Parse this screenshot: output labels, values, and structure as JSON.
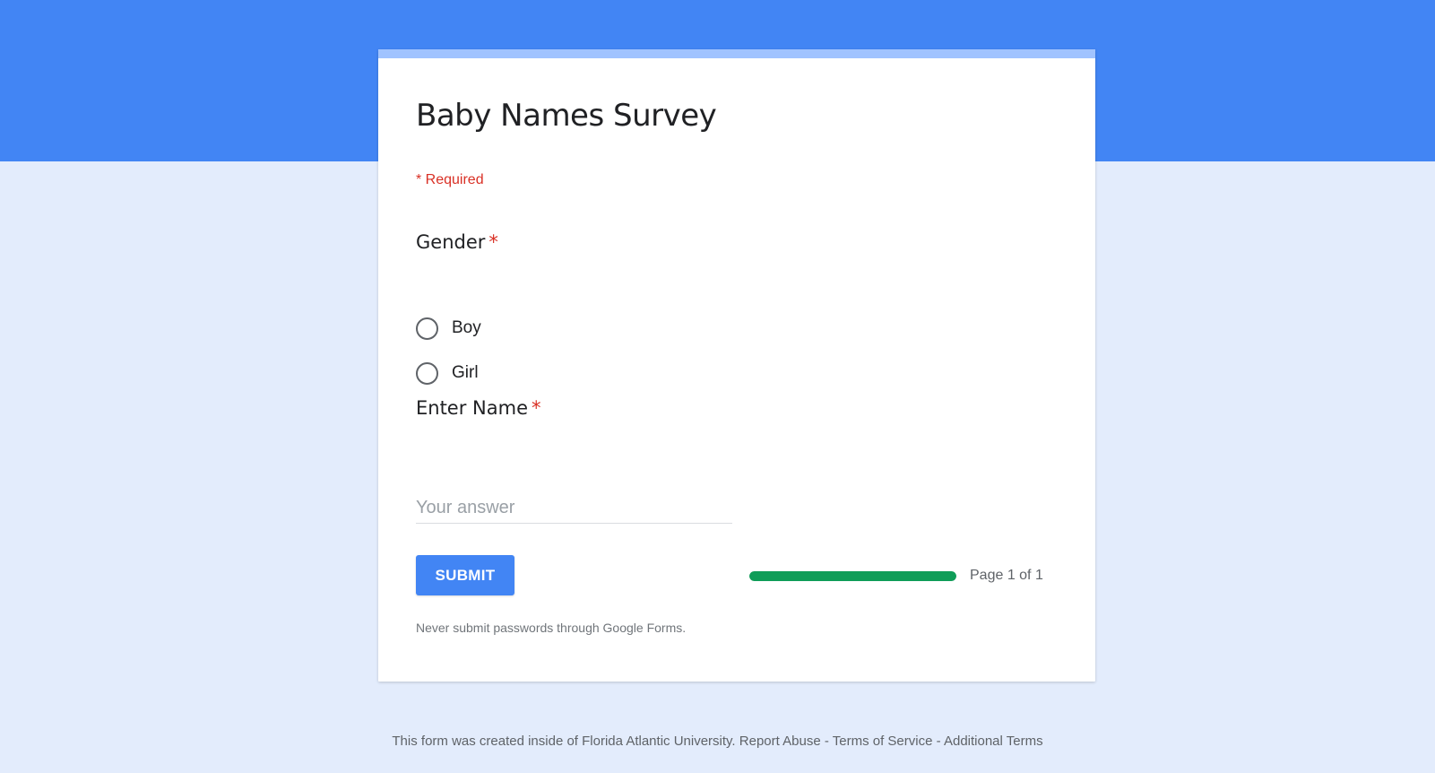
{
  "form": {
    "title": "Baby Names Survey",
    "required_note": "* Required",
    "questions": [
      {
        "title": "Gender",
        "required_mark": "*",
        "options": [
          "Boy",
          "Girl"
        ]
      },
      {
        "title": "Enter Name",
        "required_mark": "*",
        "placeholder": "Your answer",
        "value": ""
      }
    ],
    "submit_label": "SUBMIT",
    "progress": {
      "fraction": 1.0,
      "label": "Page 1 of 1"
    },
    "disclaimer": "Never submit passwords through Google Forms."
  },
  "footer": {
    "prefix": "This form was created inside of Florida Atlantic University.",
    "links": [
      "Report Abuse",
      "Terms of Service",
      "Additional Terms"
    ],
    "separator": "-"
  },
  "colors": {
    "header": "#4285f4",
    "background": "#e3ecfc",
    "accent_bar": "#a0c3ff",
    "required": "#d93025",
    "progress": "#0f9d58",
    "button": "#4285f4"
  },
  "icons": {
    "radio": "radio-unchecked-icon"
  }
}
